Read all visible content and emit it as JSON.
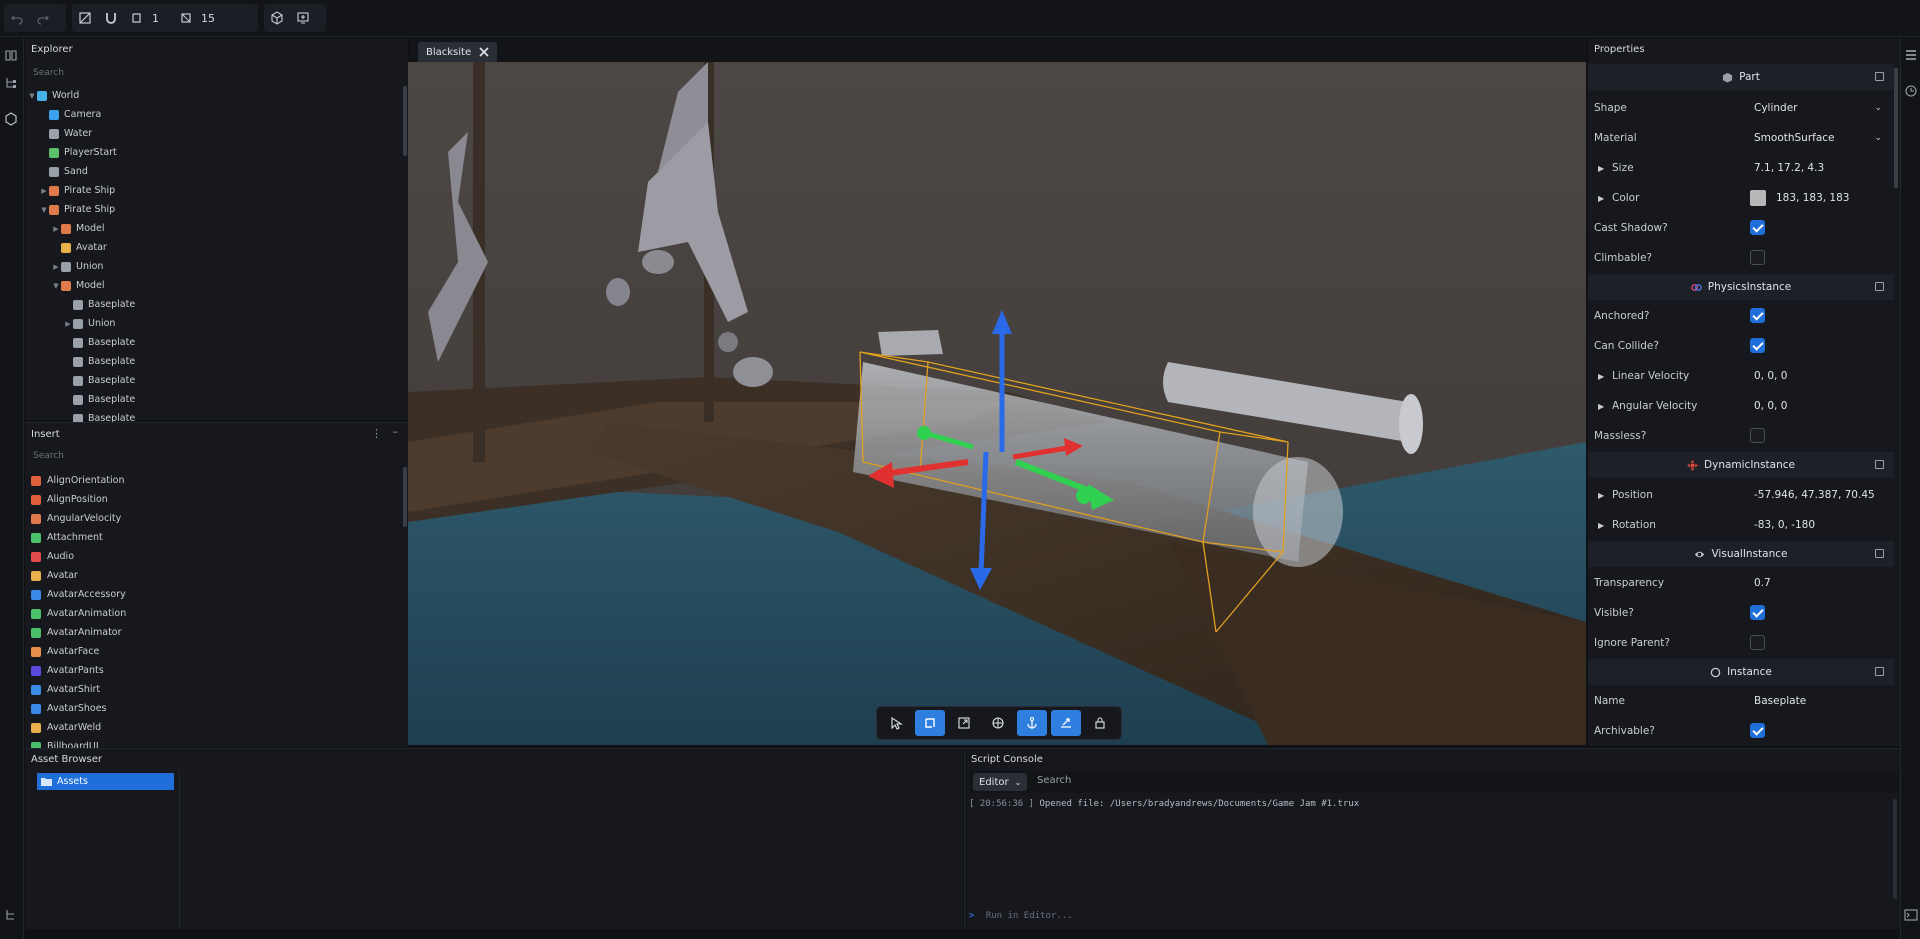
{
  "toolbar": {
    "count_a": "1",
    "count_b": "15"
  },
  "explorer": {
    "title": "Explorer",
    "search_placeholder": "Search",
    "items": [
      {
        "label": "World",
        "depth": 0,
        "expander": "open",
        "color": "#4ab0e8"
      },
      {
        "label": "Camera",
        "depth": 1,
        "expander": "",
        "color": "#3aa0f0"
      },
      {
        "label": "Water",
        "depth": 1,
        "expander": "",
        "color": "#9aa0a8"
      },
      {
        "label": "PlayerStart",
        "depth": 1,
        "expander": "",
        "color": "#5cc06a"
      },
      {
        "label": "Sand",
        "depth": 1,
        "expander": "",
        "color": "#9aa0a8"
      },
      {
        "label": "Pirate Ship",
        "depth": 1,
        "expander": "closed",
        "color": "#e07a4a"
      },
      {
        "label": "Pirate Ship",
        "depth": 1,
        "expander": "open",
        "color": "#e07a4a"
      },
      {
        "label": "Model",
        "depth": 2,
        "expander": "closed",
        "color": "#e07a4a"
      },
      {
        "label": "Avatar",
        "depth": 2,
        "expander": "",
        "color": "#e8b04a"
      },
      {
        "label": "Union",
        "depth": 2,
        "expander": "closed",
        "color": "#9aa0a8"
      },
      {
        "label": "Model",
        "depth": 2,
        "expander": "open",
        "color": "#e07a4a"
      },
      {
        "label": "Baseplate",
        "depth": 3,
        "expander": "",
        "color": "#9aa0a8"
      },
      {
        "label": "Union",
        "depth": 3,
        "expander": "closed",
        "color": "#9aa0a8"
      },
      {
        "label": "Baseplate",
        "depth": 3,
        "expander": "",
        "color": "#9aa0a8"
      },
      {
        "label": "Baseplate",
        "depth": 3,
        "expander": "",
        "color": "#9aa0a8"
      },
      {
        "label": "Baseplate",
        "depth": 3,
        "expander": "",
        "color": "#9aa0a8"
      },
      {
        "label": "Baseplate",
        "depth": 3,
        "expander": "",
        "color": "#9aa0a8"
      },
      {
        "label": "Baseplate",
        "depth": 3,
        "expander": "",
        "color": "#9aa0a8"
      }
    ]
  },
  "insert": {
    "title": "Insert",
    "search_placeholder": "Search",
    "items": [
      {
        "label": "AlignOrientation",
        "color": "#e0603a"
      },
      {
        "label": "AlignPosition",
        "color": "#e0603a"
      },
      {
        "label": "AngularVelocity",
        "color": "#e07a4a"
      },
      {
        "label": "Attachment",
        "color": "#4ac06a"
      },
      {
        "label": "Audio",
        "color": "#e04a4a"
      },
      {
        "label": "Avatar",
        "color": "#e8b04a"
      },
      {
        "label": "AvatarAccessory",
        "color": "#3a8ae8"
      },
      {
        "label": "AvatarAnimation",
        "color": "#4ac06a"
      },
      {
        "label": "AvatarAnimator",
        "color": "#4ac06a"
      },
      {
        "label": "AvatarFace",
        "color": "#e8904a"
      },
      {
        "label": "AvatarPants",
        "color": "#5a4ae0"
      },
      {
        "label": "AvatarShirt",
        "color": "#3a8ae8"
      },
      {
        "label": "AvatarShoes",
        "color": "#3a8ae8"
      },
      {
        "label": "AvatarWeld",
        "color": "#e8b04a"
      },
      {
        "label": "BillboardUI",
        "color": "#4ac06a"
      }
    ]
  },
  "viewport": {
    "tab_label": "Blacksite"
  },
  "properties": {
    "title": "Properties",
    "sections": {
      "part": "Part",
      "physics": "PhysicsInstance",
      "dynamic": "DynamicInstance",
      "visual": "VisualInstance",
      "instance": "Instance"
    },
    "shape": {
      "label": "Shape",
      "value": "Cylinder"
    },
    "material": {
      "label": "Material",
      "value": "SmoothSurface"
    },
    "size": {
      "label": "Size",
      "value": "7.1, 17.2, 4.3"
    },
    "color": {
      "label": "Color",
      "value": "183, 183, 183",
      "swatch": "#b7b7b7"
    },
    "cast_shadow": {
      "label": "Cast Shadow?",
      "checked": true
    },
    "climbable": {
      "label": "Climbable?",
      "checked": false
    },
    "anchored": {
      "label": "Anchored?",
      "checked": true
    },
    "can_collide": {
      "label": "Can Collide?",
      "checked": true
    },
    "linear_velocity": {
      "label": "Linear Velocity",
      "value": "0, 0, 0"
    },
    "angular_velocity": {
      "label": "Angular Velocity",
      "value": "0, 0, 0"
    },
    "massless": {
      "label": "Massless?",
      "checked": false
    },
    "position": {
      "label": "Position",
      "value": "-57.946, 47.387, 70.45"
    },
    "rotation": {
      "label": "Rotation",
      "value": "-83, 0, -180"
    },
    "transparency": {
      "label": "Transparency",
      "value": "0.7"
    },
    "visible": {
      "label": "Visible?",
      "checked": true
    },
    "ignore_parent": {
      "label": "Ignore Parent?",
      "checked": false
    },
    "name": {
      "label": "Name",
      "value": "Baseplate"
    },
    "archivable": {
      "label": "Archivable?",
      "checked": true
    }
  },
  "asset_browser": {
    "title": "Asset Browser",
    "root": "Assets"
  },
  "console": {
    "title": "Script Console",
    "context": "Editor",
    "search_placeholder": "Search",
    "log_time": "[ 20:56:36 ]",
    "log_message": "Opened file: /Users/bradyandrews/Documents/Game Jam #1.trux",
    "command_placeholder": "Run in Editor..."
  },
  "colors": {
    "accent": "#1e6fd9",
    "axis_x": "#e03030",
    "axis_y": "#30d050",
    "axis_z": "#2a6ae8",
    "selection": "#e0a020"
  }
}
